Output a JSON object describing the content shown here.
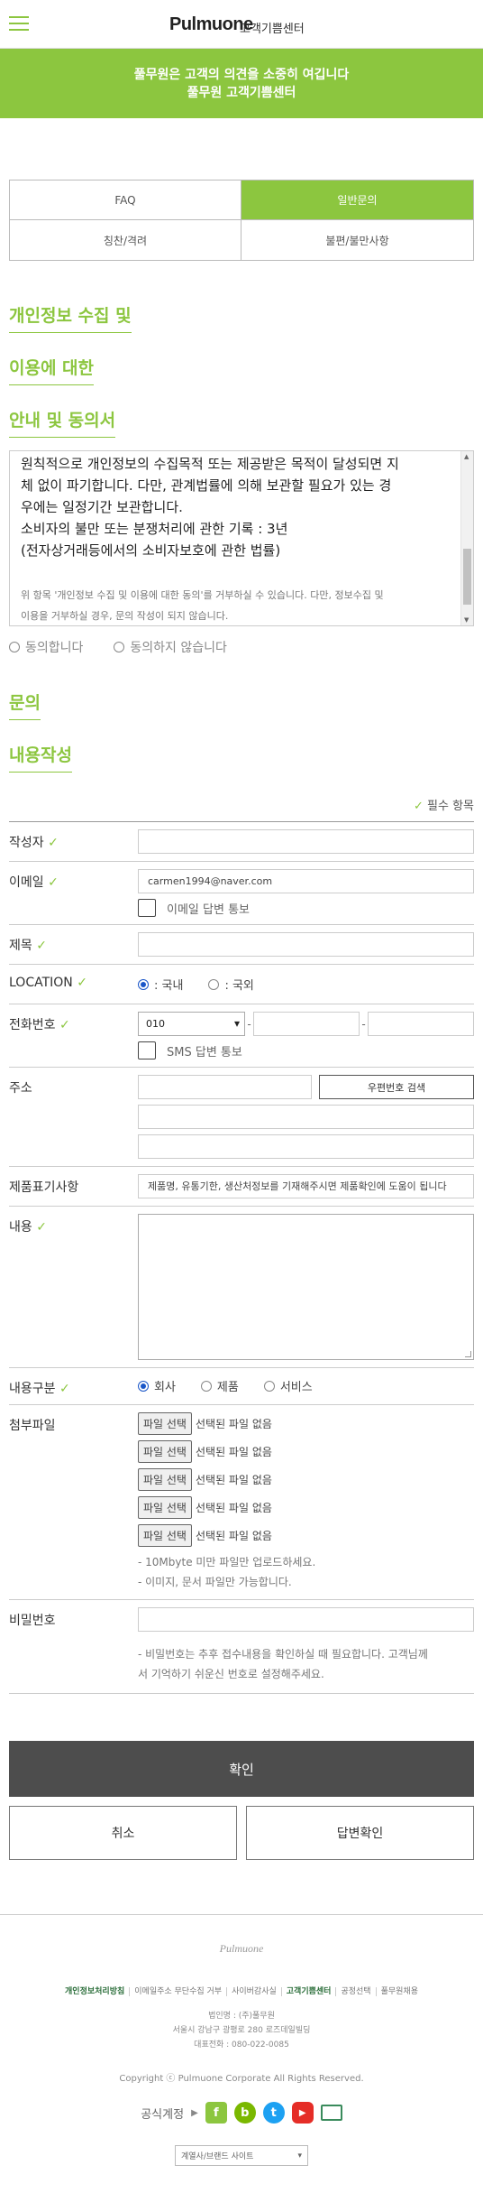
{
  "header": {
    "brand": "Pulmuone",
    "subtitle": "고객기쁨센터"
  },
  "banner": {
    "line1": "풀무원은 고객의 의견을 소중히 여깁니다",
    "line2": "풀무원 고객기쁨센터"
  },
  "tabs": [
    {
      "label": "FAQ"
    },
    {
      "label": "일반문의",
      "active": true
    },
    {
      "label": "칭찬/격려"
    },
    {
      "label": "불편/불만사항"
    }
  ],
  "privacy": {
    "title_lines": [
      "개인정보 수집 및",
      "이용에 대한",
      "안내 및 동의서"
    ],
    "text_lines": [
      "원칙적으로 개인정보의 수집목적 또는 제공받은 목적이 달성되면 지",
      "체 없이 파기합니다. 다만, 관계법률에 의해 보관할 필요가 있는 경",
      "우에는 일정기간 보관합니다.",
      "소비자의 불만 또는 분쟁처리에 관한 기록 : 3년",
      "(전자상거래등에서의 소비자보호에 관한 법률)"
    ],
    "note_lines": [
      "위 항목 '개인정보 수집 및 이용에 대한 동의'를 거부하실 수 있습니다. 다만, 정보수집 및",
      "이용을 거부하실 경우, 문의 작성이 되지 않습니다."
    ],
    "agree": "동의합니다",
    "disagree": "동의하지 않습니다"
  },
  "inquiry": {
    "title_lines": [
      "문의",
      "내용작성"
    ],
    "required_note": "필수 항목"
  },
  "form": {
    "writer_label": "작성자",
    "email_label": "이메일",
    "email_value": "carmen1994@naver.com",
    "email_reply": "이메일 답변 통보",
    "subject_label": "제목",
    "location_label": "LOCATION",
    "location_domestic": ": 국내",
    "location_overseas": ": 국외",
    "phone_label": "전화번호",
    "phone_prefix": "010",
    "sms_reply": "SMS 답변 통보",
    "address_label": "주소",
    "zip_button": "우편번호 검색",
    "product_label": "제품표기사항",
    "product_placeholder": "제품명, 유통기한, 생산처정보를 기재해주시면 제품확인에 도움이 됩니다",
    "content_label": "내용",
    "category_label": "내용구분",
    "category_options": [
      "회사",
      "제품",
      "서비스"
    ],
    "attach_label": "첨부파일",
    "file_button": "파일 선택",
    "file_none": "선택된 파일 없음",
    "attach_hint1": "- 10Mbyte 미만 파일만 업로드하세요.",
    "attach_hint2": "- 이미지, 문서 파일만 가능합니다.",
    "password_label": "비밀번호",
    "password_hint1": "- 비밀번호는 추후 접수내용을 확인하실 때 필요합니다. 고객님께",
    "password_hint2": "서 기억하기 쉬운신 번호로 설정해주세요."
  },
  "buttons": {
    "confirm": "확인",
    "cancel": "취소",
    "check_reply": "답변확인"
  },
  "footer": {
    "logo": "Pulmuone",
    "links": [
      "개인정보처리방침",
      "이메일주소 무단수집 거부",
      "사이버감사실",
      "고객기쁨센터",
      "공정선택",
      "풀무원채용"
    ],
    "company": "법인명 : (주)풀무원",
    "address": "서울시 강남구 광평로 280 로즈데일빌딩",
    "phone": "대표전화 : 080-022-0085",
    "copyright": "Copyright ⓒ Pulmuone Corporate All Rights Reserved.",
    "sns_label": "공식계정",
    "site_select": "계열사/브랜드 사이트"
  }
}
